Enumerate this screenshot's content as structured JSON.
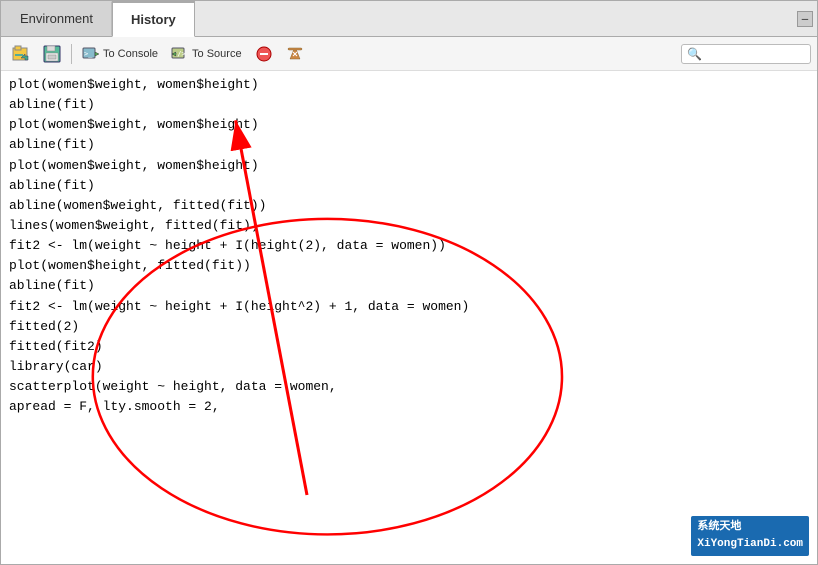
{
  "tabs": [
    {
      "id": "environment",
      "label": "Environment",
      "active": false
    },
    {
      "id": "history",
      "label": "History",
      "active": true
    }
  ],
  "toolbar": {
    "btn_load_label": "Load",
    "btn_save_label": "Save",
    "btn_to_console_label": "To Console",
    "btn_to_source_label": "To Source",
    "btn_remove_label": "Remove",
    "btn_clear_label": "Clear",
    "search_placeholder": "🔍"
  },
  "code_lines": [
    {
      "text": "plot(women$weight, women$height)",
      "selected": false
    },
    {
      "text": "abline(fit)",
      "selected": false
    },
    {
      "text": "plot(women$weight, women$height)",
      "selected": false
    },
    {
      "text": "abline(fit)",
      "selected": false
    },
    {
      "text": "plot(women$weight, women$height)",
      "selected": false
    },
    {
      "text": "abline(fit)",
      "selected": false
    },
    {
      "text": "abline(women$weight, fitted(fit))",
      "selected": false
    },
    {
      "text": "lines(women$weight, fitted(fit))",
      "selected": false
    },
    {
      "text": "fit2 <- lm(weight ~ height + I(height(2), data = women))",
      "selected": false
    },
    {
      "text": "plot(women$height, fitted(fit))",
      "selected": false
    },
    {
      "text": "abline(fit)",
      "selected": false
    },
    {
      "text": "fit2 <- lm(weight ~ height + I(height^2) + 1, data = women)",
      "selected": false
    },
    {
      "text": "fitted(2)",
      "selected": false
    },
    {
      "text": "fitted(fit2)",
      "selected": false
    },
    {
      "text": "library(car)",
      "selected": false
    },
    {
      "text": "scatterplot(weight ~ height, data = women,",
      "selected": false
    },
    {
      "text": "apread = F, lty.smooth = 2,",
      "selected": false
    }
  ],
  "watermark": "系统天地\nXiYongTianDi.com"
}
